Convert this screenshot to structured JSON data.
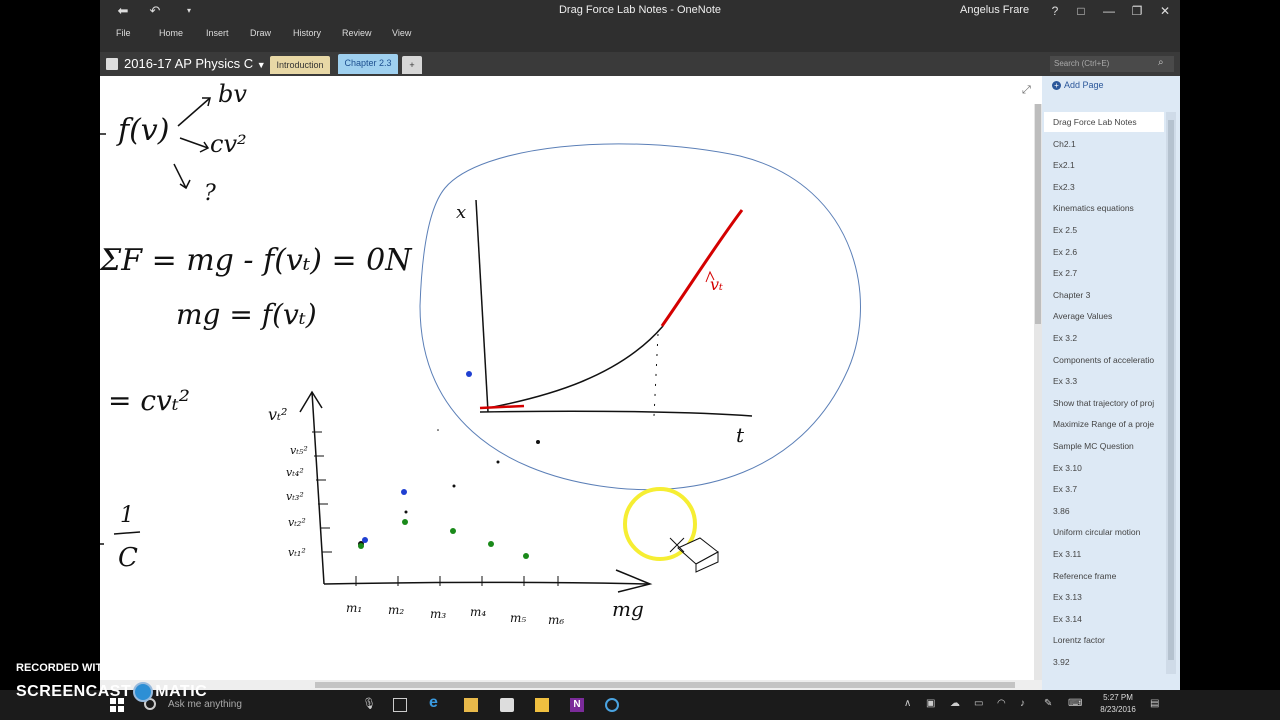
{
  "window": {
    "title": "Drag Force Lab Notes - OneNote",
    "user": "Angelus Frare",
    "controls": [
      "?",
      "□",
      "—",
      "❐",
      "✕"
    ]
  },
  "ribbon": {
    "tabs": [
      "File",
      "Home",
      "Insert",
      "Draw",
      "History",
      "Review",
      "View"
    ]
  },
  "notebook": {
    "name": "2016-17 AP Physics C",
    "sections": [
      "Introduction",
      "Chapter 2.3",
      "+"
    ],
    "active_section": "Chapter 2.3",
    "search_placeholder": "Search (Ctrl+E)"
  },
  "pages": {
    "add_label": "Add Page",
    "items": [
      "Drag Force Lab Notes",
      "Ch2.1",
      "Ex2.1",
      "Ex2.3",
      "Kinematics equations",
      "Ex 2.5",
      "Ex 2.6",
      "Ex 2.7",
      "Chapter 3",
      "Average Values",
      "Ex 3.2",
      "Components of acceleratio",
      "Ex 3.3",
      "Show that trajectory of proj",
      "Maximize Range of a proje",
      "Sample MC Question",
      "Ex 3.10",
      "Ex 3.7",
      "3.86",
      "Uniform circular motion",
      "Ex 3.11",
      "Reference frame",
      "Ex 3.13",
      "Ex 3.14",
      "Lorentz factor",
      "3.92"
    ],
    "selected": "Drag Force Lab Notes"
  },
  "taskbar": {
    "search_placeholder": "Ask me anything",
    "time": "5:27 PM",
    "date": "8/23/2016"
  },
  "watermark": {
    "line1": "RECORDED WITH",
    "brand_left": "SCREENCAST",
    "brand_right": "MATIC"
  },
  "ink": {
    "f_of_v": "f(v)",
    "b_v": "bv",
    "c_v2": "cv²",
    "question": "?",
    "sum_f": "ΣF = mg - f(vₜ) = 0N",
    "mg_eq": "mg = f(vₜ)",
    "eq_cv": "= cvₜ²",
    "frac_num": "1",
    "frac_den": "C",
    "axis_x": "x",
    "axis_t": "t",
    "vt_mark": "vₜ",
    "y_axis": "vₜ²",
    "y_ticks": [
      "vₜ₅²",
      "vₜ₄²",
      "vₜ₃²",
      "vₜ₂²",
      "vₜ₁²"
    ],
    "x_ticks": [
      "m₁",
      "m₂",
      "m₃",
      "m₄",
      "m₅",
      "m₆"
    ],
    "x_axis": "mg"
  },
  "colors": {
    "ink_black": "#111111",
    "ink_red": "#d40000",
    "ink_blue": "#1f3fd1",
    "ink_green": "#1a8a1a",
    "lasso": "#5b7fb7",
    "cursor_highlight": "#f6ee33"
  }
}
